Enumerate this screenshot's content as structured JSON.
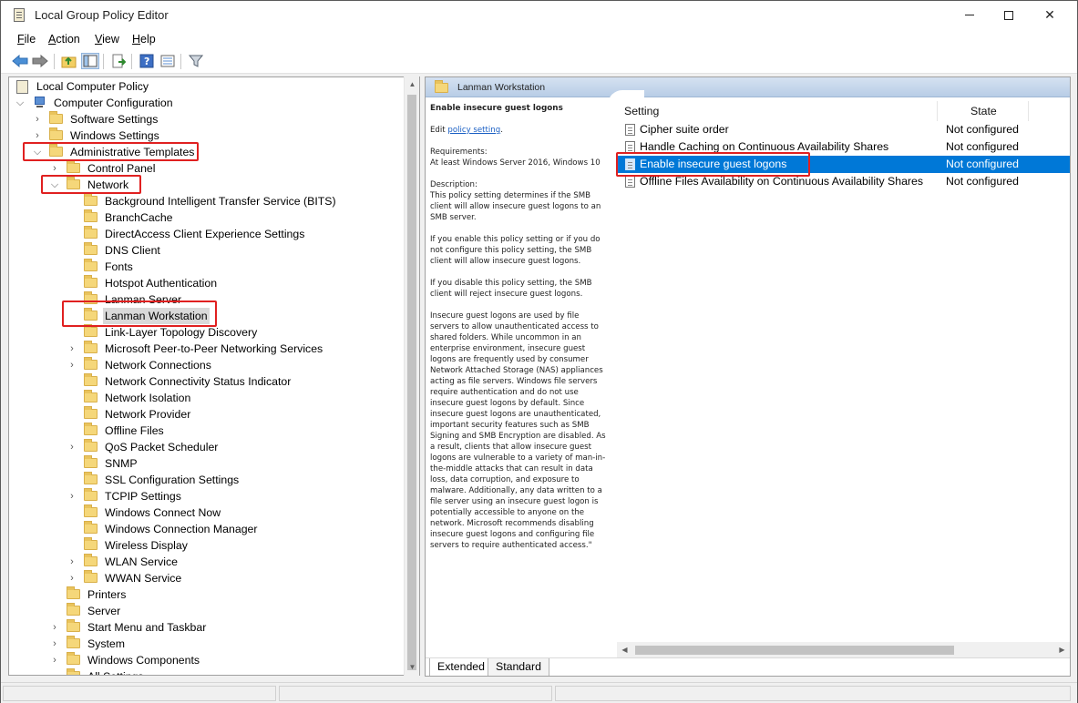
{
  "window": {
    "title": "Local Group Policy Editor"
  },
  "menu": [
    "File",
    "Action",
    "View",
    "Help"
  ],
  "toolbar_icons": [
    "back-arrow-icon",
    "forward-arrow-icon",
    "up-folder-icon",
    "show-hide-tree-icon",
    "export-list-icon",
    "help-icon",
    "properties-icon",
    "filter-icon"
  ],
  "tree": {
    "root": "Local Computer Policy",
    "computer_configuration": "Computer Configuration",
    "software_settings": "Software Settings",
    "windows_settings": "Windows Settings",
    "administrative_templates": "Administrative Templates",
    "control_panel": "Control Panel",
    "network": "Network",
    "network_children": [
      "Background Intelligent Transfer Service (BITS)",
      "BranchCache",
      "DirectAccess Client Experience Settings",
      "DNS Client",
      "Fonts",
      "Hotspot Authentication",
      "Lanman Server",
      "Lanman Workstation",
      "Link-Layer Topology Discovery",
      "Microsoft Peer-to-Peer Networking Services",
      "Network Connections",
      "Network Connectivity Status Indicator",
      "Network Isolation",
      "Network Provider",
      "Offline Files",
      "QoS Packet Scheduler",
      "SNMP",
      "SSL Configuration Settings",
      "TCPIP Settings",
      "Windows Connect Now",
      "Windows Connection Manager",
      "Wireless Display",
      "WLAN Service",
      "WWAN Service"
    ],
    "admin_children_after": [
      "Printers",
      "Server",
      "Start Menu and Taskbar",
      "System",
      "Windows Components",
      "All Settings"
    ]
  },
  "right_pane": {
    "header": "Lanman Workstation",
    "description": {
      "title": "Enable insecure guest logons",
      "edit_prefix": "Edit ",
      "edit_link": "policy setting",
      "edit_suffix": ".",
      "requirements_label": "Requirements:",
      "requirements_value": "At least Windows Server 2016, Windows 10",
      "description_label": "Description:",
      "paragraphs": [
        "This policy setting determines if the SMB client will allow insecure guest logons to an SMB server.",
        "If you enable this policy setting or if you do not configure this policy setting, the SMB client will allow insecure guest logons.",
        "If you disable this policy setting, the SMB client will reject insecure guest logons.",
        "Insecure guest logons are used by file servers to allow unauthenticated access to shared folders. While uncommon in an enterprise environment, insecure guest logons are frequently used by consumer Network Attached Storage (NAS) appliances acting as file servers. Windows file servers require authentication and do not use insecure guest logons by default. Since insecure guest logons are unauthenticated, important security features such as SMB Signing and SMB Encryption are disabled. As a result, clients that allow insecure guest logons are vulnerable to a variety of man-in-the-middle attacks that can result in data loss, data corruption, and exposure to malware. Additionally, any data written to a file server using an insecure guest logon is potentially accessible to anyone on the network. Microsoft recommends disabling insecure guest logons and configuring file servers to require authenticated access.\""
      ]
    },
    "columns": {
      "setting": "Setting",
      "state": "State"
    },
    "policies": [
      {
        "name": "Cipher suite order",
        "state": "Not configured"
      },
      {
        "name": "Handle Caching on Continuous Availability Shares",
        "state": "Not configured"
      },
      {
        "name": "Enable insecure guest logons",
        "state": "Not configured"
      },
      {
        "name": "Offline Files Availability on Continuous Availability Shares",
        "state": "Not configured"
      }
    ],
    "tabs": [
      "Extended",
      "Standard"
    ]
  },
  "highlight_color": "#e02020",
  "selection_color": "#0078d7"
}
